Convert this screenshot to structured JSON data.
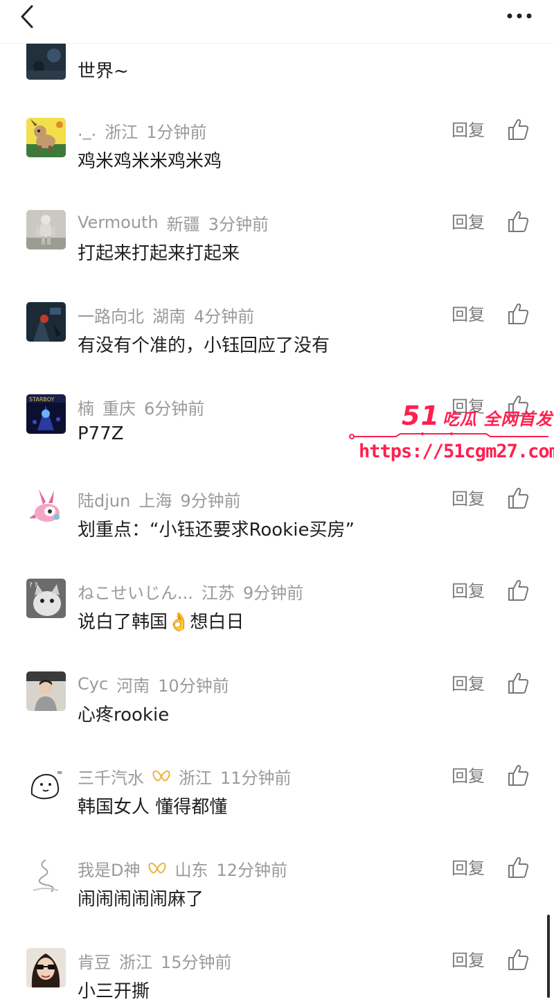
{
  "topbar": {
    "back_icon": "chevron-left-icon",
    "more_icon": "more-horizontal-icon"
  },
  "comments": [
    {
      "name": "",
      "location": "",
      "time": "",
      "content": "世界~",
      "reply_label": "回复",
      "avatar": "dark-space-avatar"
    },
    {
      "name": "._.",
      "location": "浙江",
      "time": "1分钟前",
      "content": "鸡米鸡米米鸡米鸡",
      "reply_label": "回复",
      "avatar": "cartoon-dog-avatar"
    },
    {
      "name": "Vermouth",
      "location": "新疆",
      "time": "3分钟前",
      "content": "打起来打起来打起来",
      "reply_label": "回复",
      "avatar": "stone-figure-avatar"
    },
    {
      "name": "一路向北",
      "location": "湖南",
      "time": "4分钟前",
      "content": "有没有个准的，小钰回应了没有",
      "reply_label": "回复",
      "avatar": "dark-fantasy-avatar"
    },
    {
      "name": "楠",
      "location": "重庆",
      "time": "6分钟前",
      "content": "P77Z",
      "reply_label": "回复",
      "avatar": "starboy-avatar"
    },
    {
      "name": "陆djun",
      "location": "上海",
      "time": "9分钟前",
      "content": "划重点：“小钰还要求Rookie买房”",
      "reply_label": "回复",
      "avatar": "pink-creature-avatar"
    },
    {
      "name": "ねこせいじん...",
      "location": "江苏",
      "time": "9分钟前",
      "content": "说白了韩国",
      "content_emoji": "👌",
      "content_after": "想白日",
      "reply_label": "回复",
      "avatar": "cat-photo-avatar"
    },
    {
      "name": "Cyc",
      "location": "河南",
      "time": "10分钟前",
      "content": "心疼rookie",
      "reply_label": "回复",
      "avatar": "person-photo-avatar"
    },
    {
      "name": "三千汽水",
      "location": "浙江",
      "time": "11分钟前",
      "content": "韩国女人 懂得都懂",
      "reply_label": "回复",
      "avatar": "doodle-bear-avatar",
      "badge": "gold-wings-badge"
    },
    {
      "name": "我是D神",
      "location": "山东",
      "time": "12分钟前",
      "content": "闹闹闹闹闹麻了",
      "reply_label": "回复",
      "avatar": "ink-sketch-avatar",
      "badge": "gold-wings-badge"
    },
    {
      "name": "肯豆",
      "location": "浙江",
      "time": "15分钟前",
      "content": "小三开撕",
      "reply_label": "回复",
      "avatar": "woman-sunglasses-avatar"
    }
  ],
  "watermark": {
    "top_number": "51",
    "top_text": "吃瓜 全网首发",
    "url": "https://51cgm27.com"
  },
  "colors": {
    "meta_gray": "#9a9a9a",
    "watermark_red": "#ff1f4f",
    "badge_gold": "#f0b23a"
  }
}
